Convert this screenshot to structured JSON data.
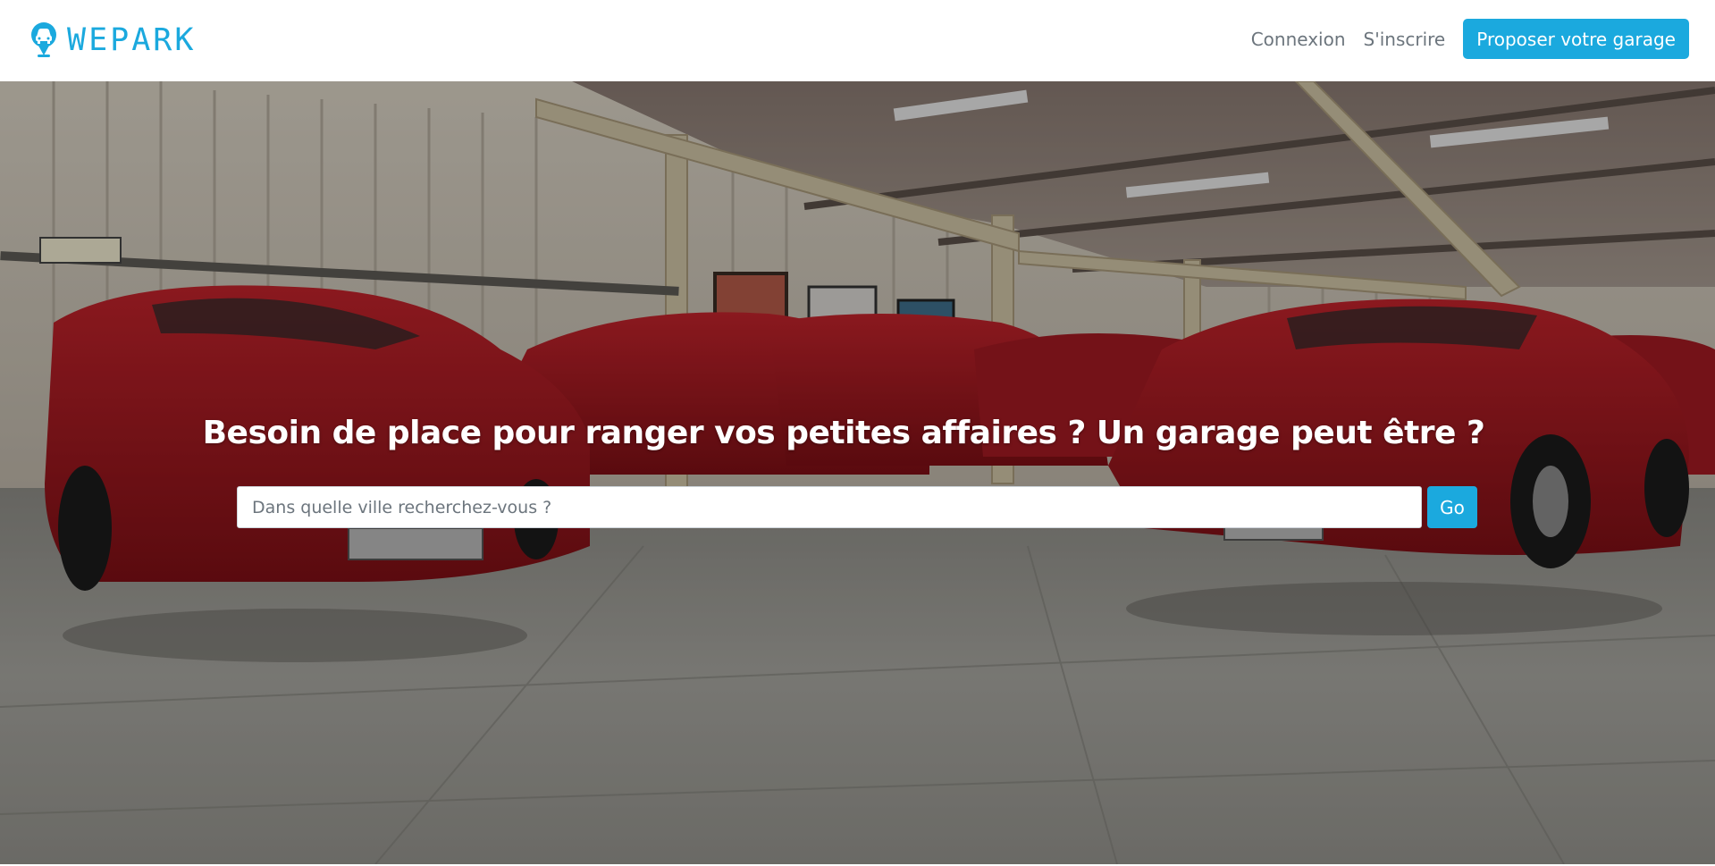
{
  "brand": {
    "name": "WEPARK",
    "icon": "car-pin-icon",
    "color": "#1ba9de"
  },
  "nav": {
    "login_label": "Connexion",
    "signup_label": "S'inscrire",
    "propose_label": "Proposer votre garage"
  },
  "hero": {
    "background": "garage-with-red-sports-cars-photo",
    "title": "Besoin de place pour ranger vos petites affaires ? Un garage peut être ?",
    "search": {
      "value": "",
      "placeholder": "Dans quelle ville recherchez-vous ?",
      "button_label": "Go"
    }
  },
  "colors": {
    "accent": "#1ba9de",
    "nav_text": "#6c757d"
  }
}
